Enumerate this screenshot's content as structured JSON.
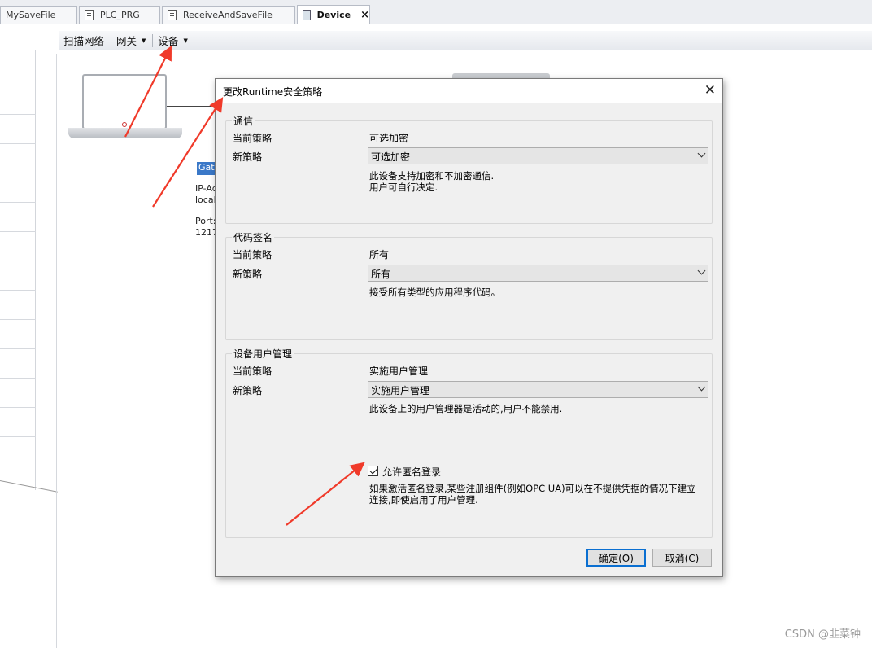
{
  "tabs": [
    {
      "label": "MySaveFile",
      "icon": "none"
    },
    {
      "label": "PLC_PRG",
      "icon": "document-icon"
    },
    {
      "label": "ReceiveAndSaveFile",
      "icon": "document-icon"
    },
    {
      "label": "Device",
      "icon": "device-icon",
      "active": true
    }
  ],
  "toolbar": {
    "scan_network": "扫描网络",
    "gateway": "网关",
    "device": "设备"
  },
  "diagram": {
    "gateway_name": "Gate",
    "ip_label": "IP-Ad",
    "ip_value": "local",
    "port_label": "Port:",
    "port_value": "1217"
  },
  "dialog": {
    "title": "更改Runtime安全策略",
    "close_glyph": "✕",
    "current_policy_label": "当前策略",
    "new_policy_label": "新策略",
    "communication": {
      "title": "通信",
      "current": "可选加密",
      "new": "可选加密",
      "desc_line1": "此设备支持加密和不加密通信.",
      "desc_line2": "用户可自行决定."
    },
    "code_signing": {
      "title": "代码签名",
      "current": "所有",
      "new": "所有",
      "desc_line1": "接受所有类型的应用程序代码。"
    },
    "user_management": {
      "title": "设备用户管理",
      "current": "实施用户管理",
      "new": "实施用户管理",
      "desc_line1": "此设备上的用户管理器是活动的,用户不能禁用.",
      "anonymous_login_label": "允许匿名登录",
      "anonymous_login_checked": true,
      "anon_desc_line1": "如果激活匿名登录,某些注册组件(例如OPC UA)可以在不提供凭据的情况下建立",
      "anon_desc_line2": "连接,即使启用了用户管理."
    },
    "ok_button": "确定(O)",
    "cancel_button": "取消(C)"
  },
  "watermark": "CSDN @韭菜钟",
  "colors": {
    "annotation_red": "#f03a2a",
    "selection_blue": "#3a78c8",
    "primary_border": "#0a6fd1"
  }
}
